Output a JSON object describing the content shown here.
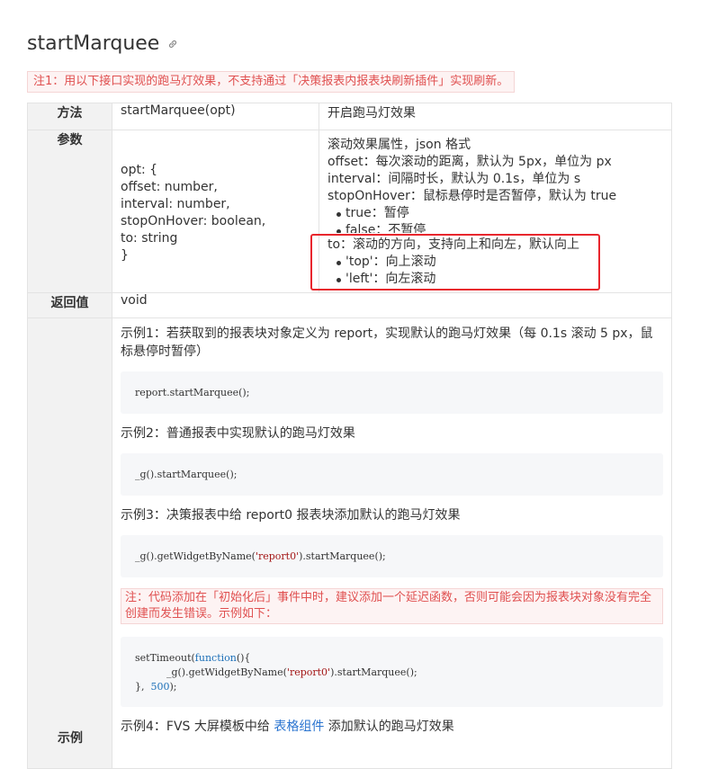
{
  "page_title": "startMarquee",
  "note_top": "注1：用以下接口实现的跑马灯效果，不支持通过「决策报表内报表块刷新插件」实现刷新。",
  "table": {
    "row_method": {
      "label": "方法",
      "signature": "startMarquee(opt)",
      "description": "开启跑马灯效果"
    },
    "row_params": {
      "label": "参数",
      "code_lines": [
        "opt: {",
        "offset: number,",
        "interval: number,",
        "stopOnHover: boolean,",
        "to: string",
        "}"
      ],
      "desc_lines": [
        "滚动效果属性，json 格式",
        "offset：每次滚动的距离，默认为 5px，单位为 px",
        "interval：间隔时长，默认为 0.1s，单位为 s",
        "stopOnHover：鼠标悬停时是否暂停，默认为 true"
      ],
      "hover_options": [
        "true：暂停",
        "false：不暂停"
      ],
      "to_line": "to：滚动的方向，支持向上和向左，默认向上",
      "to_options": [
        "'top'：向上滚动",
        "'left'：向左滚动"
      ]
    },
    "row_return": {
      "label": "返回值",
      "value": "void"
    },
    "row_example": {
      "label": "示例",
      "ex1_text": "示例1：若获取到的报表块对象定义为 report，实现默认的跑马灯效果（每 0.1s 滚动 5 px，鼠标悬停时暂停）",
      "ex1_code": "report.startMarquee();",
      "ex2_text": "示例2：普通报表中实现默认的跑马灯效果",
      "ex2_code": "_g().startMarquee();",
      "ex3_text": "示例3：决策报表中给 report0 报表块添加默认的跑马灯效果",
      "ex3_code_pre": "_g().getWidgetByName(",
      "ex3_code_str": "'report0'",
      "ex3_code_post": ").startMarquee();",
      "ex3_note": "注：代码添加在「初始化后」事件中时，建议添加一个延迟函数，否则可能会因为报表块对象没有完全创建而发生错误。示例如下：",
      "ex3b_line1_fn": "setTimeout(",
      "ex3b_line1_kw": "function",
      "ex3b_line1_end": "(){",
      "ex3b_line2_pre": "          _g().getWidgetByName(",
      "ex3b_line2_str": "'report0'",
      "ex3b_line2_post": ").startMarquee();",
      "ex3b_line3_pre": "},  ",
      "ex3b_line3_num": "500",
      "ex3b_line3_end": ");",
      "ex4_text_pre": "示例4：FVS 大屏模板中给 ",
      "ex4_link": "表格组件",
      "ex4_text_post": " 添加默认的跑马灯效果"
    }
  }
}
